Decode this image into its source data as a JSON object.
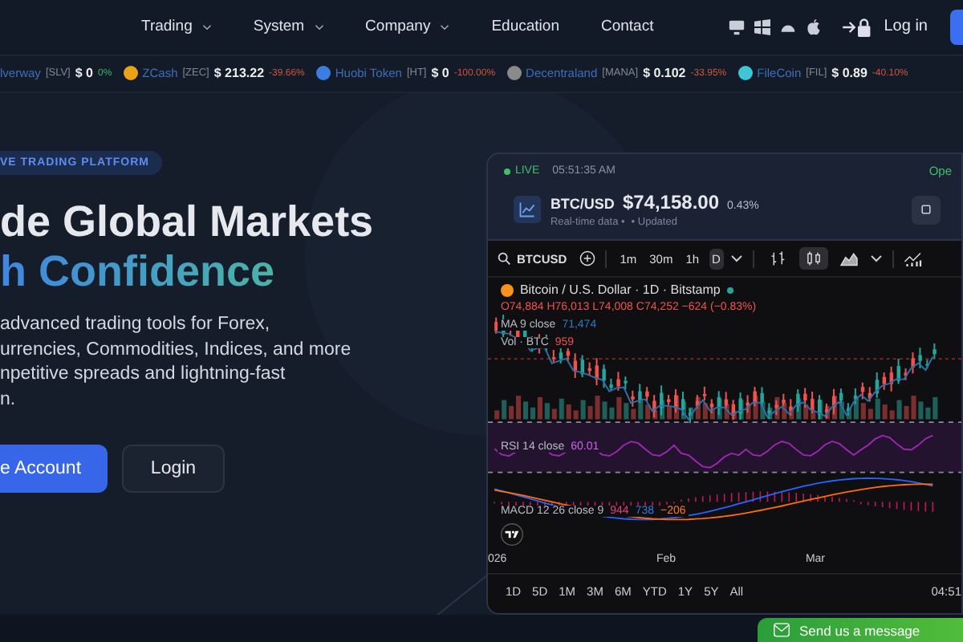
{
  "nav": {
    "items": [
      {
        "label": "Trading",
        "caret": true
      },
      {
        "label": "System",
        "caret": true
      },
      {
        "label": "Company",
        "caret": true
      },
      {
        "label": "Education",
        "caret": false
      },
      {
        "label": "Contact",
        "caret": false
      }
    ],
    "login": "Log in"
  },
  "ticker": [
    {
      "name": "lverway",
      "symbol": "[SLV]",
      "price": "$ 0",
      "change": "0%",
      "negative": false
    },
    {
      "name": "ZCash",
      "symbol": "[ZEC]",
      "price": "$ 213.22",
      "change": "-39.66%",
      "negative": true,
      "color": "#e8a317"
    },
    {
      "name": "Huobi Token",
      "symbol": "[HT]",
      "price": "$ 0",
      "change": "-100.00%",
      "negative": true,
      "color": "#3b7de0"
    },
    {
      "name": "Decentraland",
      "symbol": "[MANA]",
      "price": "$ 0.102",
      "change": "-33.95%",
      "negative": true,
      "color": "#8a8a8a"
    },
    {
      "name": "FileCoin",
      "symbol": "[FIL]",
      "price": "$ 0.89",
      "change": "-40.10%",
      "negative": true,
      "color": "#3ec6d6"
    }
  ],
  "hero": {
    "badge": "VE TRADING PLATFORM",
    "title_1": "de Global Markets",
    "title_2": "h Confidence",
    "lines": [
      "advanced trading tools for Forex,",
      "urrencies, Commodities, Indices, and more",
      "npetitive spreads and lightning-fast",
      "n."
    ],
    "primary_button": "e Account",
    "secondary_button": "Login"
  },
  "widget": {
    "live": "LIVE",
    "time": "05:51:35 AM",
    "status": "Ope",
    "pair": "BTC/USD",
    "price": "$74,158.00",
    "change": "0.43%",
    "subtitle": "Real-time data •",
    "updated": "• Updated",
    "symbol": "BTCUSD",
    "intervals": [
      {
        "label": "1m",
        "selected": false
      },
      {
        "label": "30m",
        "selected": false
      },
      {
        "label": "1h",
        "selected": false
      },
      {
        "label": "D",
        "selected": true
      }
    ],
    "chart_types": [
      {
        "kind": "bars",
        "selected": false
      },
      {
        "kind": "candles",
        "selected": true
      },
      {
        "kind": "area",
        "selected": false
      }
    ],
    "legend": "Bitcoin / U.S. Dollar · 1D · Bitstamp",
    "ohlc": "O74,884 H76,013 L74,008 C74,252 −624 (−0.83%)",
    "ma_label": "MA 9 close",
    "ma_value": "71,474",
    "vol_label": "Vol · BTC",
    "vol_value": "959",
    "rsi_label": "RSI 14 close",
    "rsi_value": "60.01",
    "macd_label": "MACD 12 26 close 9",
    "macd_values": [
      "944",
      "738",
      "−206"
    ],
    "dates": [
      "026",
      "Feb",
      "Mar"
    ],
    "ranges": [
      "1D",
      "5D",
      "1M",
      "3M",
      "6M",
      "YTD",
      "1Y",
      "5Y",
      "All"
    ],
    "clock": "04:51"
  },
  "message_button": "Send us a message"
}
